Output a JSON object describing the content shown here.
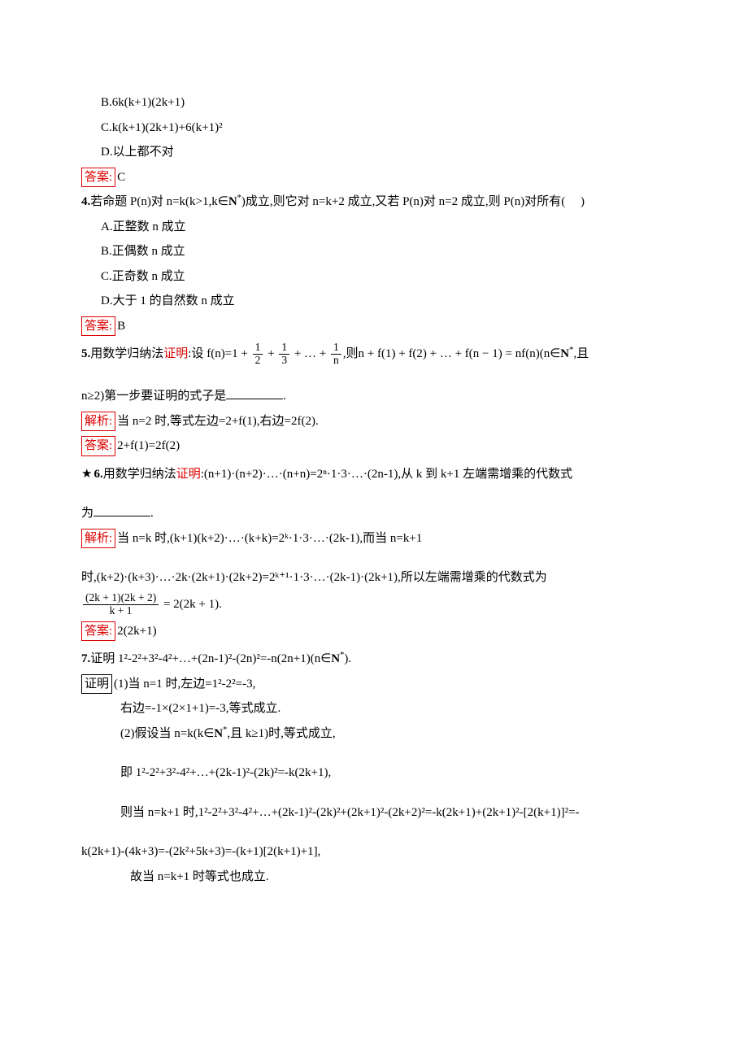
{
  "q3": {
    "optB": "B.6k(k+1)(2k+1)",
    "optC": "C.k(k+1)(2k+1)+6(k+1)²",
    "optD": "D.以上都不对",
    "answer_label": "答案:",
    "answer": "C"
  },
  "q4": {
    "num": "4.",
    "stem_a": "若命题 P(n)对 n=k(k>1,k∈",
    "N": "N",
    "star": "*",
    "stem_b": ")成立,则它对 n=k+2 成立,又若 P(n)对 n=2 成立,则 P(n)对所有(",
    "paren_end": ")",
    "optA": "A.正整数 n 成立",
    "optB": "B.正偶数 n 成立",
    "optC": "C.正奇数 n 成立",
    "optD": "D.大于 1 的自然数 n 成立",
    "answer_label": "答案:",
    "answer": "B"
  },
  "q5": {
    "num": "5.",
    "stem_a": "用数学归纳法",
    "prove": "证明",
    "stem_b": ":设 f(n)=1 + ",
    "f1n": "1",
    "f1d": "2",
    "plus1": " + ",
    "f2n": "1",
    "f2d": "3",
    "plus2": " + … + ",
    "f3n": "1",
    "f3d": "n",
    "stem_c": ",则n + f(1) + f(2) + … + f(n − 1) = nf(n)(n∈",
    "N": "N",
    "star": "*",
    "stem_d": ",且",
    "line2a": "n≥2)第一步要证明的式子是",
    "dot": ".",
    "explain_label": "解析:",
    "explain": "当 n=2 时,等式左边=2+f(1),右边=2f(2).",
    "answer_label": "答案:",
    "answer": "2+f(1)=2f(2)"
  },
  "q6": {
    "star": "★",
    "num": "6.",
    "stem_a": "用数学归纳法",
    "prove": "证明",
    "stem_b": ":(n+1)·(n+2)·…·(n+n)=2ⁿ·1·3·…·(2n-1),从 k 到 k+1 左端需增乘的代数式",
    "line2": "为",
    "dot": ".",
    "explain_label": "解析:",
    "explain1": "当 n=k 时,(k+1)(k+2)·…·(k+k)=2ᵏ·1·3·…·(2k-1),而当 n=k+1",
    "explain2": "时,(k+2)·(k+3)·…·2k·(2k+1)·(2k+2)=2ᵏ⁺¹·1·3·…·(2k-1)·(2k+1),所以左端需增乘的代数式为",
    "frac_num": "(2k + 1)(2k + 2)",
    "frac_den": "k + 1",
    "eq": " = 2(2k + 1).",
    "answer_label": "答案:",
    "answer": "2(2k+1)"
  },
  "q7": {
    "num": "7.",
    "stem": "证明 1²-2²+3²-4²+…+(2n-1)²-(2n)²=-n(2n+1)(n∈",
    "N": "N",
    "star": "*",
    "stem_end": ").",
    "proof_label": "证明",
    "p1a": "(1)当 n=1 时,左边=1²-2²=-3,",
    "p1b": "右边=-1×(2×1+1)=-3,等式成立.",
    "p2a": "(2)假设当 n=k(k∈",
    "p2a_end": ",且 k≥1)时,等式成立,",
    "p2b": "即 1²-2²+3²-4²+…+(2k-1)²-(2k)²=-k(2k+1),",
    "p2c": "则当 n=k+1 时,1²-2²+3²-4²+…+(2k-1)²-(2k)²+(2k+1)²-(2k+2)²=-k(2k+1)+(2k+1)²-[2(k+1)]²=-",
    "p2d": "k(2k+1)-(4k+3)=-(2k²+5k+3)=-(k+1)[2(k+1)+1],",
    "p2e": "故当 n=k+1 时等式也成立."
  }
}
